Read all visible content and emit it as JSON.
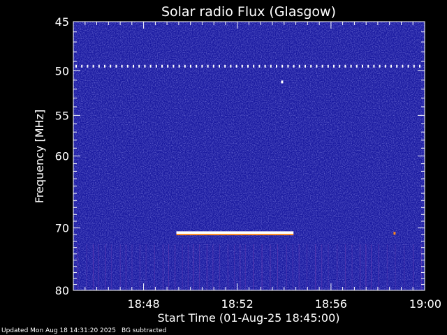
{
  "chart_data": {
    "type": "heatmap",
    "title": "Solar radio Flux (Glasgow)",
    "xlabel": "Start Time (01-Aug-25 18:45:00)",
    "ylabel": "Frequency [MHz]",
    "x_axis": {
      "unit": "minutes after 18:45:00",
      "range": [
        0,
        15
      ],
      "ticks": [
        {
          "value": 3,
          "label": "18:48"
        },
        {
          "value": 7,
          "label": "18:52"
        },
        {
          "value": 11,
          "label": "18:56"
        },
        {
          "value": 15,
          "label": "19:00"
        }
      ],
      "minor_step": 0.5
    },
    "y_axis": {
      "scale": "log",
      "inverted": true,
      "range": [
        45,
        80
      ],
      "ticks": [
        45,
        50,
        55,
        60,
        70,
        80
      ],
      "minor_step": 1
    },
    "colormap": {
      "background": "#1a1aa0",
      "mid": "#3f3fd0",
      "high": "#ffffff",
      "edge": "#ff8a1e"
    },
    "features": [
      {
        "kind": "dotted-line",
        "frequency": 49.5,
        "x": [
          0,
          15
        ],
        "color": "#ffffff"
      },
      {
        "kind": "dot",
        "frequency": 51.2,
        "x": 8.9,
        "color": "#ffffff"
      },
      {
        "kind": "band",
        "frequency": [
          70.5,
          71.0
        ],
        "x": [
          4.4,
          9.4
        ],
        "color": "#ffffff",
        "edge": "#ff8a1e"
      },
      {
        "kind": "dot",
        "frequency": 70.8,
        "x": 13.7,
        "color": "#ff8a1e"
      },
      {
        "kind": "vertical-striations",
        "frequency": [
          72.5,
          80
        ],
        "x": [
          0,
          15
        ],
        "color": "#6a3ab0"
      }
    ]
  },
  "footer": {
    "updated": "Updated Mon Aug 18 14:31:20 2025",
    "bg": "BG subtracted"
  }
}
